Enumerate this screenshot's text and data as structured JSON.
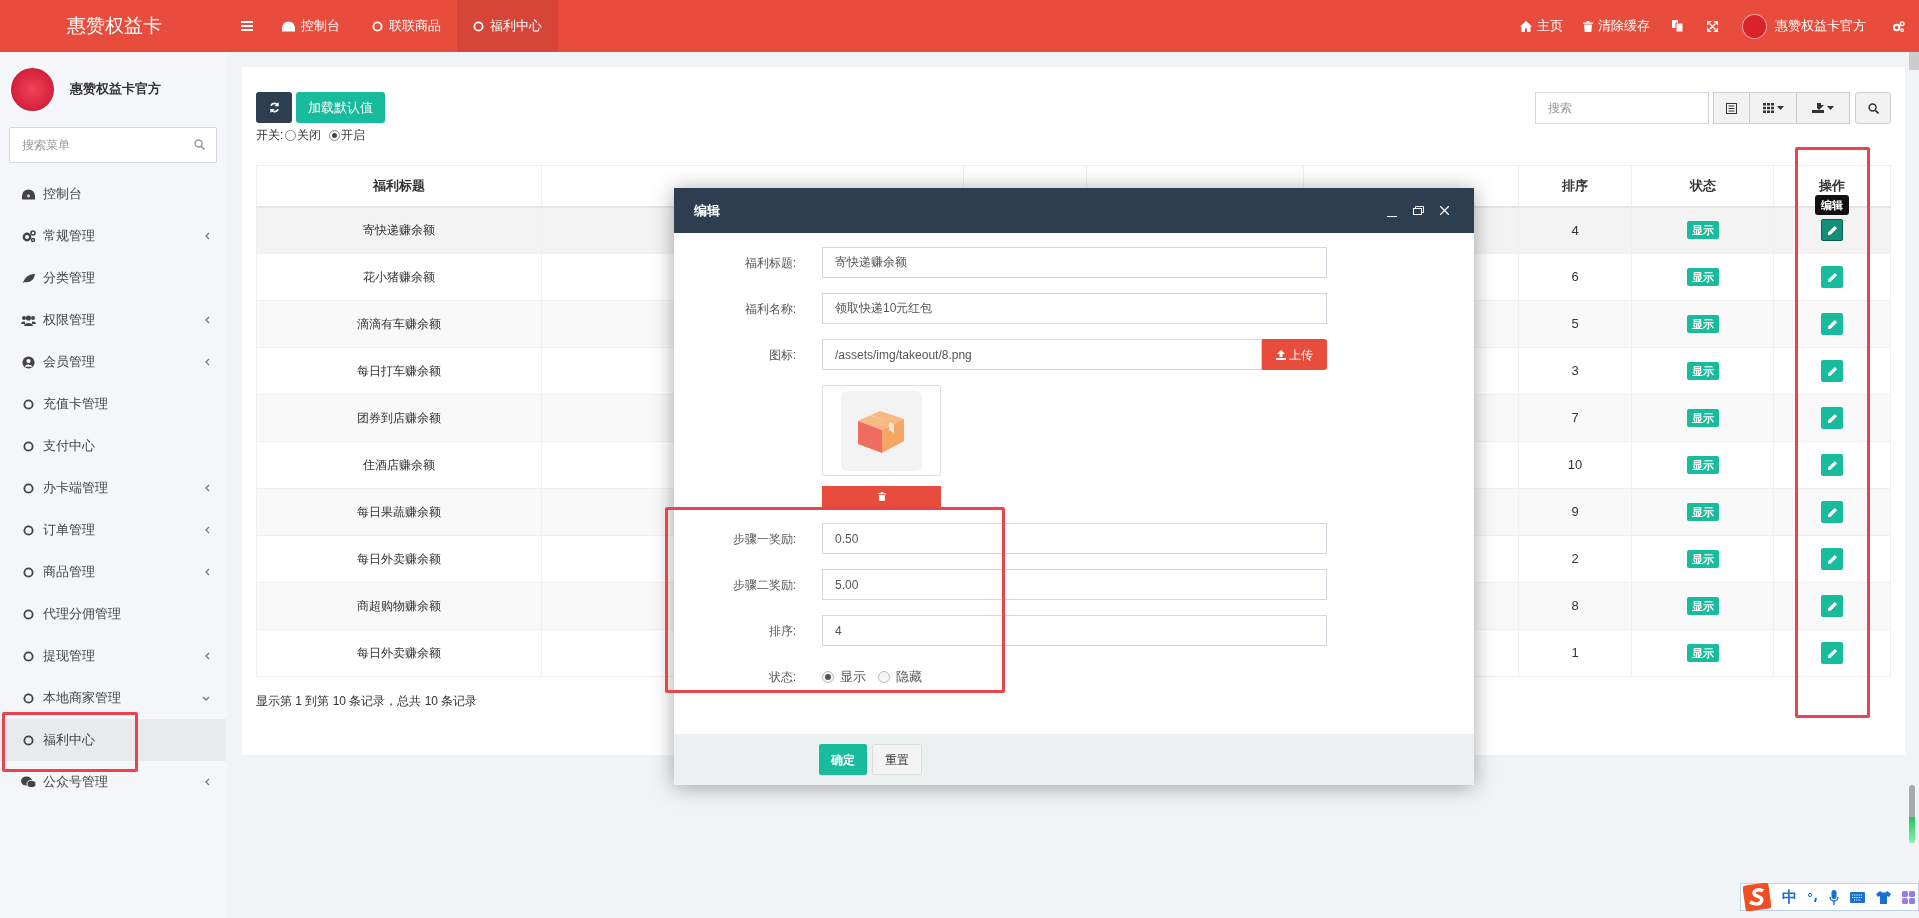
{
  "brand": {
    "title": "惠赞权益卡"
  },
  "nav_tabs": [
    {
      "kind": "dashboard",
      "label": "控制台",
      "selected": false
    },
    {
      "kind": "circle",
      "label": "联联商品",
      "selected": false
    },
    {
      "kind": "circle",
      "label": "福利中心",
      "selected": true
    }
  ],
  "header_links": [
    {
      "kind": "home",
      "label": "主页"
    },
    {
      "kind": "trash",
      "label": "清除缓存"
    }
  ],
  "user": {
    "name": "惠赞权益卡官方"
  },
  "sidebar": {
    "profile_name": "惠赞权益卡官方",
    "search": {
      "placeholder": "搜索菜单"
    },
    "items": [
      {
        "kind": "dashboard",
        "label": "控制台",
        "expandable": false,
        "selected": false
      },
      {
        "kind": "cogs",
        "label": "常规管理",
        "expandable": true,
        "expanded": false,
        "selected": false
      },
      {
        "kind": "leaf",
        "label": "分类管理",
        "expandable": false,
        "selected": false
      },
      {
        "kind": "users",
        "label": "权限管理",
        "expandable": true,
        "expanded": false,
        "selected": false
      },
      {
        "kind": "user",
        "label": "会员管理",
        "expandable": true,
        "expanded": false,
        "selected": false
      },
      {
        "kind": "circle",
        "label": "充值卡管理",
        "expandable": false,
        "selected": false
      },
      {
        "kind": "circle",
        "label": "支付中心",
        "expandable": false,
        "selected": false
      },
      {
        "kind": "circle",
        "label": "办卡端管理",
        "expandable": true,
        "expanded": false,
        "selected": false
      },
      {
        "kind": "circle",
        "label": "订单管理",
        "expandable": true,
        "expanded": false,
        "selected": false
      },
      {
        "kind": "circle",
        "label": "商品管理",
        "expandable": true,
        "expanded": false,
        "selected": false
      },
      {
        "kind": "circle",
        "label": "代理分佣管理",
        "expandable": false,
        "selected": false
      },
      {
        "kind": "circle",
        "label": "提现管理",
        "expandable": true,
        "expanded": false,
        "selected": false
      },
      {
        "kind": "circle",
        "label": "本地商家管理",
        "expandable": true,
        "expanded": true,
        "selected": false
      },
      {
        "kind": "circle",
        "label": "福利中心",
        "expandable": false,
        "selected": true
      },
      {
        "kind": "chat",
        "label": "公众号管理",
        "expandable": true,
        "expanded": false,
        "selected": false
      }
    ]
  },
  "toolbar": {
    "load_button": "加载默认值",
    "switch_label": "开关:",
    "switch_options": [
      {
        "label": "关闭",
        "selected": false
      },
      {
        "label": "开启",
        "selected": true
      }
    ],
    "search": {
      "placeholder": "搜索"
    }
  },
  "table": {
    "columns": {
      "title": "福利标题",
      "sort": "排序",
      "status": "状态",
      "actions": "操作"
    },
    "tooltip": "编辑",
    "rows": [
      {
        "title": "寄快递赚余额",
        "sort": "4",
        "status": "显示",
        "hovered": true
      },
      {
        "title": "花小猪赚余额",
        "sort": "6",
        "status": "显示",
        "hovered": false
      },
      {
        "title": "滴滴有车赚余额",
        "sort": "5",
        "status": "显示",
        "hovered": false
      },
      {
        "title": "每日打车赚余额",
        "sort": "3",
        "status": "显示",
        "hovered": false
      },
      {
        "title": "团券到店赚余额",
        "sort": "7",
        "status": "显示",
        "hovered": false
      },
      {
        "title": "住酒店赚余额",
        "sort": "10",
        "status": "显示",
        "hovered": false
      },
      {
        "title": "每日果蔬赚余额",
        "sort": "9",
        "status": "显示",
        "hovered": false
      },
      {
        "title": "每日外卖赚余额",
        "sort": "2",
        "status": "显示",
        "hovered": false
      },
      {
        "title": "商超购物赚余额",
        "sort": "8",
        "status": "显示",
        "hovered": false
      },
      {
        "title": "每日外卖赚余额",
        "sort": "1",
        "status": "显示",
        "hovered": false
      }
    ],
    "footer": "显示第 1 到第 10 条记录，总共 10 条记录"
  },
  "dialog": {
    "title": "编辑",
    "fields": [
      {
        "label": "福利标题:",
        "value": "寄快递赚余额"
      },
      {
        "label": "福利名称:",
        "value": "领取快递10元红包"
      }
    ],
    "icon_field": {
      "label": "图标:",
      "value": "/assets/img/takeout/8.png",
      "upload_button": "上传"
    },
    "fields_after": [
      {
        "label": "步骤一奖励:",
        "value": "0.50"
      },
      {
        "label": "步骤二奖励:",
        "value": "5.00"
      },
      {
        "label": "排序:",
        "value": "4"
      }
    ],
    "status": {
      "label": "状态:",
      "options": [
        {
          "label": "显示",
          "selected": true
        },
        {
          "label": "隐藏",
          "selected": false
        }
      ]
    },
    "buttons": [
      {
        "kind": "primary",
        "label": "确定"
      },
      {
        "kind": "default",
        "label": "重置"
      }
    ]
  },
  "ime": {
    "mode": "中"
  }
}
